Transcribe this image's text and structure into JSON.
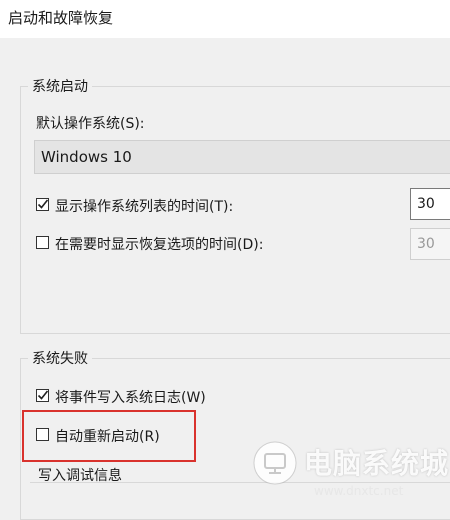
{
  "window": {
    "title": "启动和故障恢复"
  },
  "system_startup": {
    "group_label": "系统启动",
    "default_os_label": "默认操作系统(S):",
    "default_os_value": "Windows 10",
    "show_os_list": {
      "label": "显示操作系统列表的时间(T):",
      "checked": true,
      "value": "30"
    },
    "show_recovery": {
      "label": "在需要时显示恢复选项的时间(D):",
      "checked": false,
      "value": "30"
    }
  },
  "system_failure": {
    "group_label": "系统失败",
    "write_event_log": {
      "label": "将事件写入系统日志(W)",
      "checked": true
    },
    "auto_restart": {
      "label": "自动重新启动(R)",
      "checked": false
    },
    "debug_info_label": "写入调试信息"
  },
  "watermark": {
    "text": "电脑系统城",
    "url": "www.dnxtc.net"
  },
  "colors": {
    "highlight": "#d9322d"
  }
}
